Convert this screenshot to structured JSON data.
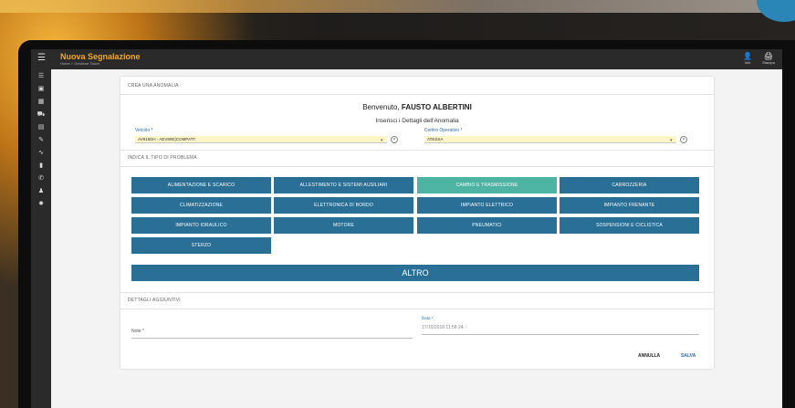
{
  "header": {
    "title": "Nuova Segnalazione",
    "subtitle": "Home > Gestione Ticket",
    "buttons": [
      {
        "icon": "user-icon",
        "label": "Info",
        "glyph": "👤"
      },
      {
        "icon": "print-icon",
        "label": "Stampa",
        "glyph": "🖨"
      }
    ]
  },
  "sidebar": {
    "items": [
      {
        "icon": "menu-icon",
        "glyph": "☰"
      },
      {
        "icon": "dashboard-icon",
        "glyph": "▣"
      },
      {
        "icon": "calendar-icon",
        "glyph": "▦"
      },
      {
        "icon": "truck-icon",
        "glyph": "⛟"
      },
      {
        "icon": "car-icon",
        "glyph": "▤"
      },
      {
        "icon": "wrench-icon",
        "glyph": "✎"
      },
      {
        "icon": "chart-icon",
        "glyph": "∿"
      },
      {
        "icon": "fuel-icon",
        "glyph": "▮"
      },
      {
        "icon": "phone-icon",
        "glyph": "✆"
      },
      {
        "icon": "users-icon",
        "glyph": "♟"
      },
      {
        "icon": "settings-icon",
        "glyph": "✹"
      }
    ]
  },
  "form": {
    "section_title": "CREA UNA ANOMALIA",
    "welcome_prefix": "Benvenuto,",
    "user_name": "FAUSTO ALBERTINI",
    "subtitle": "Inserisci i Dettagli dell'Anomalia",
    "vehicle_label": "Veicolo *",
    "vehicle_value": "AV916DH - AEV80E(COMPATT.",
    "center_label": "Centro Operativo *",
    "center_value": "ATESSA",
    "problem_section": "INDICA IL TIPO DI PROBLEMA",
    "categories": [
      {
        "label": "ALIMENTAZIONE E SCARICO",
        "active": false
      },
      {
        "label": "ALLESTIMENTO E SISTEMI AUSILIARI",
        "active": false
      },
      {
        "label": "CAMBIO E TRASMISSIONE",
        "active": true
      },
      {
        "label": "CARROZZERIA",
        "active": false
      },
      {
        "label": "CLIMATIZZAZIONE",
        "active": false
      },
      {
        "label": "ELETTRONICA DI BORDO",
        "active": false
      },
      {
        "label": "IMPIANTO ELETTRICO",
        "active": false
      },
      {
        "label": "IMPIANTO FRENANTE",
        "active": false
      },
      {
        "label": "IMPIANTO IDRAULICO",
        "active": false
      },
      {
        "label": "MOTORE",
        "active": false
      },
      {
        "label": "PNEUMATICI",
        "active": false
      },
      {
        "label": "SOSPENSIONI E CICLISTICA",
        "active": false
      },
      {
        "label": "STERZO",
        "active": false
      }
    ],
    "other_button": "ALTRO",
    "details_section": "DETTAGLI AGGIUNTIVI",
    "note_label": "Note *",
    "date_label": "Data *",
    "date_value": "17/10/2018 11:58:24",
    "cancel_label": "ANNULLA",
    "save_label": "SALVA"
  },
  "colors": {
    "header": "#2a2a2a",
    "accent": "#f5a623",
    "category_button": "#2a6f95",
    "category_active": "#4db3a3",
    "field_highlight": "#fff6c8",
    "link": "#2a6fa8"
  }
}
